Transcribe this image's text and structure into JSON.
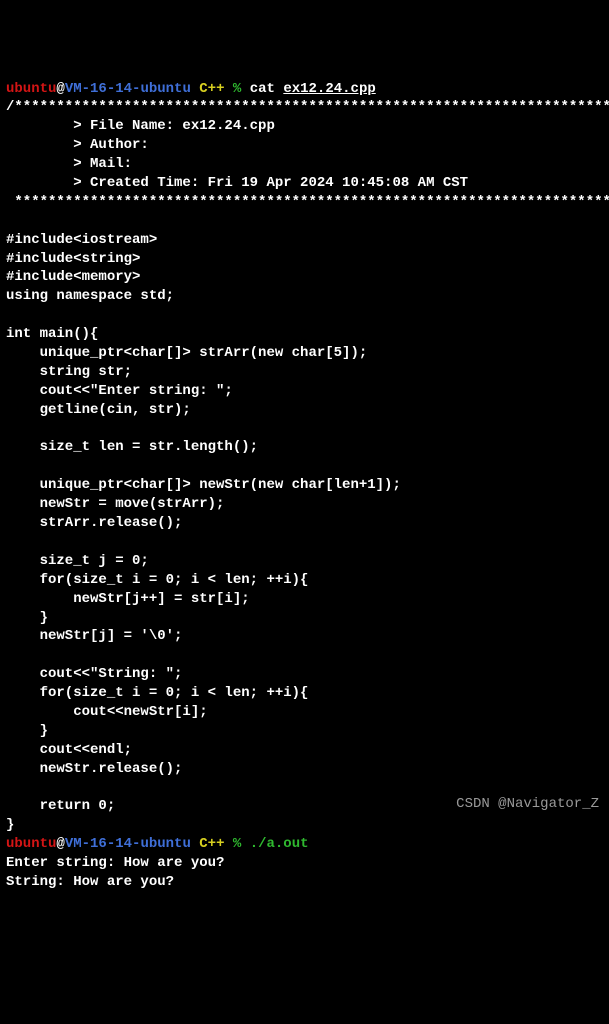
{
  "prompt1": {
    "user": "ubuntu",
    "at": "@",
    "host": "VM-16-14-ubuntu",
    "dir": "C++",
    "pct": "%",
    "cmd": "cat",
    "file": "ex12.24.cpp"
  },
  "header": {
    "top": "/*************************************************************************",
    "l1": "        > File Name: ex12.24.cpp",
    "l2": "        > Author:",
    "l3": "        > Mail:",
    "l4": "        > Created Time: Fri 19 Apr 2024 10:45:08 AM CST",
    "bot": " ************************************************************************/"
  },
  "code": {
    "inc1": "#include<iostream>",
    "inc2": "#include<string>",
    "inc3": "#include<memory>",
    "using": "using namespace std;",
    "mainDecl": "int main(){",
    "l1": "    unique_ptr<char[]> strArr(new char[5]);",
    "l2": "    string str;",
    "l3": "    cout<<\"Enter string: \";",
    "l4": "    getline(cin, str);",
    "l5": "    size_t len = str.length();",
    "l6": "    unique_ptr<char[]> newStr(new char[len+1]);",
    "l7": "    newStr = move(strArr);",
    "l8": "    strArr.release();",
    "l9": "    size_t j = 0;",
    "l10": "    for(size_t i = 0; i < len; ++i){",
    "l11": "        newStr[j++] = str[i];",
    "l12": "    }",
    "l13": "    newStr[j] = '\\0';",
    "l14": "    cout<<\"String: \";",
    "l15": "    for(size_t i = 0; i < len; ++i){",
    "l16": "        cout<<newStr[i];",
    "l17": "    }",
    "l18": "    cout<<endl;",
    "l19": "    newStr.release();",
    "l20": "    return 0;",
    "close": "}"
  },
  "prompt2": {
    "user": "ubuntu",
    "at": "@",
    "host": "VM-16-14-ubuntu",
    "dir": "C++",
    "pct": "%",
    "exec": "./a.out"
  },
  "output": {
    "o1": "Enter string: How are you?",
    "o2": "String: How are you?"
  },
  "watermark": "CSDN @Navigator_Z"
}
